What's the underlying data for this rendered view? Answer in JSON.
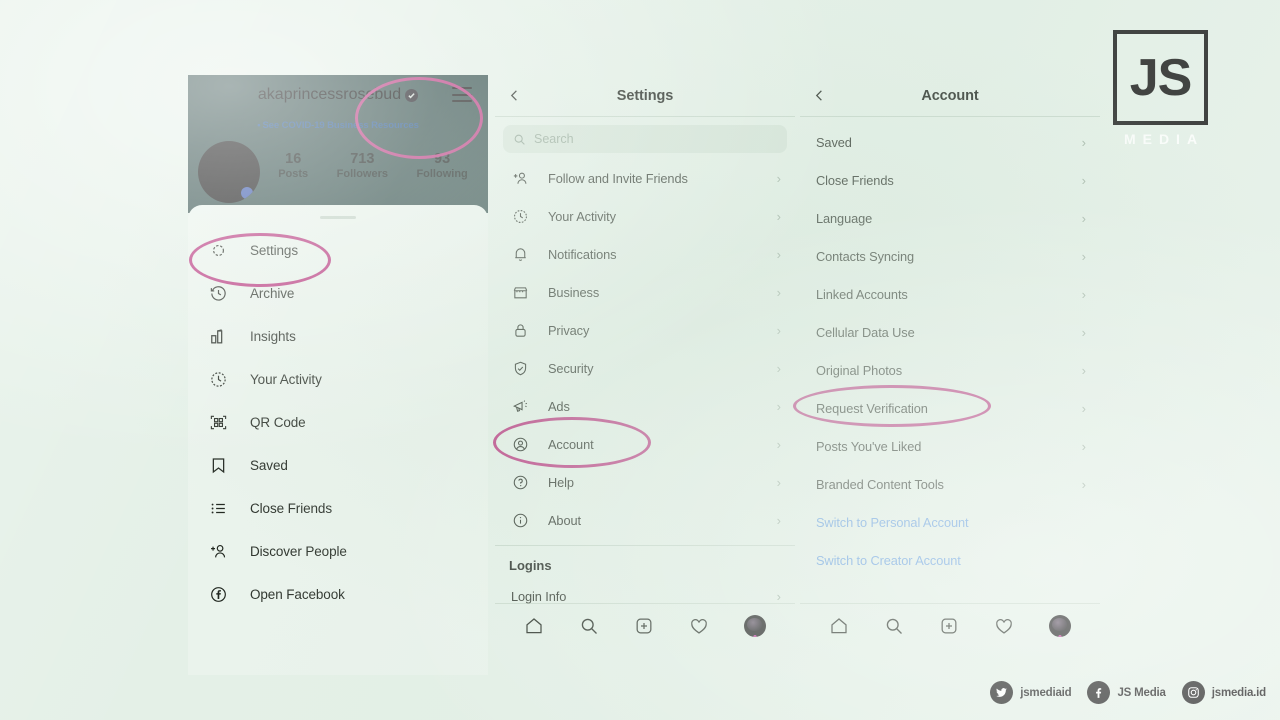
{
  "brand": {
    "logo_text": "JS",
    "logo_subtitle": "MEDIA",
    "socials": [
      {
        "icon": "twitter-icon",
        "handle": "jsmediaid"
      },
      {
        "icon": "facebook-icon",
        "handle": "JS Media"
      },
      {
        "icon": "instagram-icon",
        "handle": "jsmedia.id"
      }
    ]
  },
  "colors": {
    "page_background": "#e4f0e7",
    "profile_header": "#2d4a47",
    "annotation_pink": "#b8357e",
    "link_blue": "#5f9ae0",
    "covid_link_blue": "#1d4f8f"
  },
  "profile_panel": {
    "username": "akaprincessrosebud",
    "verified_badge": "verified-badge-icon",
    "menu_icon": "hamburger-menu-icon",
    "covid_notice": "See COVID-19 Business Resources",
    "covid_bullet": "•",
    "stats": [
      {
        "value": "16",
        "label": "Posts"
      },
      {
        "value": "713",
        "label": "Followers"
      },
      {
        "value": "93",
        "label": "Following"
      }
    ],
    "menu_items": [
      {
        "label": "Settings",
        "icon": "gear-icon"
      },
      {
        "label": "Archive",
        "icon": "archive-clock-icon"
      },
      {
        "label": "Insights",
        "icon": "insights-bars-icon"
      },
      {
        "label": "Your Activity",
        "icon": "activity-clock-icon"
      },
      {
        "label": "QR Code",
        "icon": "qr-code-icon"
      },
      {
        "label": "Saved",
        "icon": "bookmark-icon"
      },
      {
        "label": "Close Friends",
        "icon": "close-friends-list-icon"
      },
      {
        "label": "Discover People",
        "icon": "discover-people-icon"
      },
      {
        "label": "Open Facebook",
        "icon": "facebook-icon"
      }
    ]
  },
  "settings_panel": {
    "title": "Settings",
    "back_icon": "chevron-left-icon",
    "search": {
      "placeholder": "Search",
      "icon": "search-icon",
      "value": ""
    },
    "items": [
      {
        "label": "Follow and Invite Friends",
        "icon": "add-person-icon",
        "chevron": "›"
      },
      {
        "label": "Your Activity",
        "icon": "activity-clock-icon",
        "chevron": "›"
      },
      {
        "label": "Notifications",
        "icon": "bell-icon",
        "chevron": "›"
      },
      {
        "label": "Business",
        "icon": "store-icon",
        "chevron": "›"
      },
      {
        "label": "Privacy",
        "icon": "lock-icon",
        "chevron": "›"
      },
      {
        "label": "Security",
        "icon": "shield-check-icon",
        "chevron": "›"
      },
      {
        "label": "Ads",
        "icon": "megaphone-icon",
        "chevron": "›"
      },
      {
        "label": "Account",
        "icon": "account-circle-icon",
        "chevron": "›"
      },
      {
        "label": "Help",
        "icon": "question-circle-icon",
        "chevron": "›"
      },
      {
        "label": "About",
        "icon": "info-circle-icon",
        "chevron": "›"
      }
    ],
    "section_header": "Logins",
    "login_items": [
      {
        "label": "Login Info",
        "chevron": "›"
      }
    ]
  },
  "account_panel": {
    "title": "Account",
    "back_icon": "chevron-left-icon",
    "items": [
      {
        "label": "Saved",
        "chevron": "›",
        "type": "normal"
      },
      {
        "label": "Close Friends",
        "chevron": "›",
        "type": "normal"
      },
      {
        "label": "Language",
        "chevron": "›",
        "type": "normal"
      },
      {
        "label": "Contacts Syncing",
        "chevron": "›",
        "type": "normal"
      },
      {
        "label": "Linked Accounts",
        "chevron": "›",
        "type": "normal"
      },
      {
        "label": "Cellular Data Use",
        "chevron": "›",
        "type": "normal"
      },
      {
        "label": "Original Photos",
        "chevron": "›",
        "type": "normal"
      },
      {
        "label": "Request Verification",
        "chevron": "›",
        "type": "normal"
      },
      {
        "label": "Posts You've Liked",
        "chevron": "›",
        "type": "normal"
      },
      {
        "label": "Branded Content Tools",
        "chevron": "›",
        "type": "normal"
      },
      {
        "label": "Switch to Personal Account",
        "chevron": "",
        "type": "link"
      },
      {
        "label": "Switch to Creator Account",
        "chevron": "",
        "type": "link"
      }
    ]
  },
  "tabbar": {
    "items": [
      {
        "icon": "home-icon"
      },
      {
        "icon": "search-icon"
      },
      {
        "icon": "add-post-icon"
      },
      {
        "icon": "heart-icon"
      },
      {
        "icon": "profile-avatar-icon"
      }
    ]
  },
  "annotations": [
    {
      "name": "hamburger-menu-highlight",
      "target": "hamburger-menu-icon"
    },
    {
      "name": "settings-highlight",
      "target": "Settings"
    },
    {
      "name": "account-highlight",
      "target": "Account"
    },
    {
      "name": "request-verification-highlight",
      "target": "Request Verification"
    }
  ]
}
